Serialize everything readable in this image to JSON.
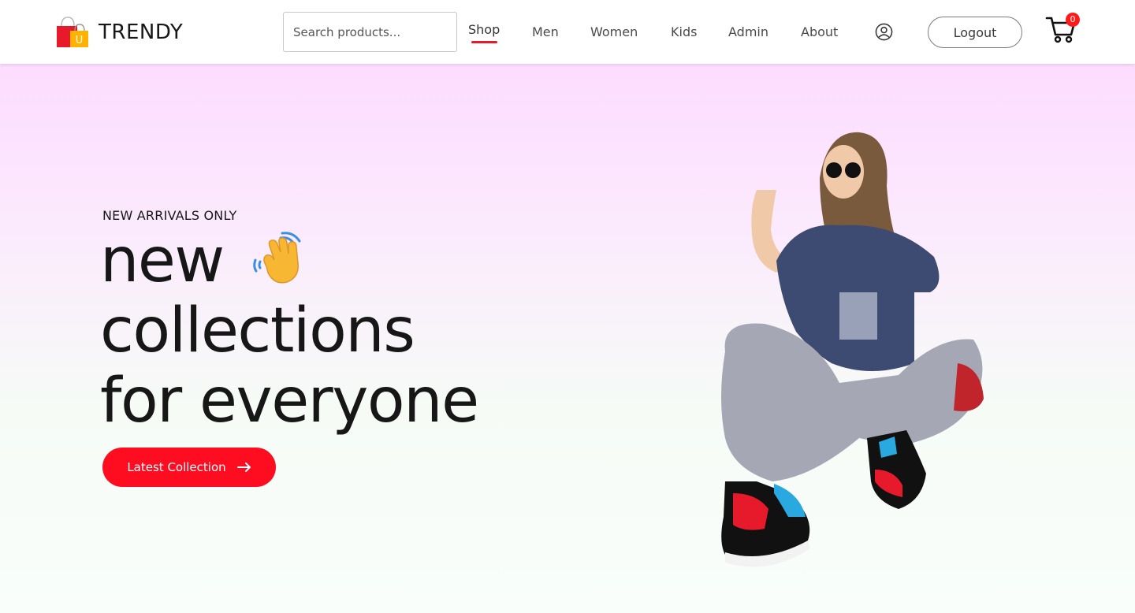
{
  "brand": {
    "name": "TRENDY",
    "logo_letter": "U"
  },
  "search": {
    "placeholder": "Search products..."
  },
  "nav": {
    "items": [
      {
        "label": "Shop",
        "active": true
      },
      {
        "label": "Men"
      },
      {
        "label": "Women"
      },
      {
        "label": "Kids"
      },
      {
        "label": "Admin"
      },
      {
        "label": "About"
      }
    ]
  },
  "header": {
    "user_icon": "user-circle-icon",
    "logout_label": "Logout",
    "cart_icon": "shopping-cart-icon",
    "cart_count": "0"
  },
  "hero": {
    "eyebrow": "NEW ARRIVALS ONLY",
    "line1": "new",
    "line2": "collections",
    "line3": "for everyone",
    "wave_icon": "waving-hand-icon",
    "cta_label": "Latest Collection",
    "cta_icon": "arrow-right-icon"
  },
  "colors": {
    "accent": "#fe0c20",
    "active_underline": "#e61a2b",
    "badge": "#ff1a1a",
    "text": "#171717",
    "hero_top": "#fddcff",
    "hero_bottom": "#f9fefb"
  }
}
